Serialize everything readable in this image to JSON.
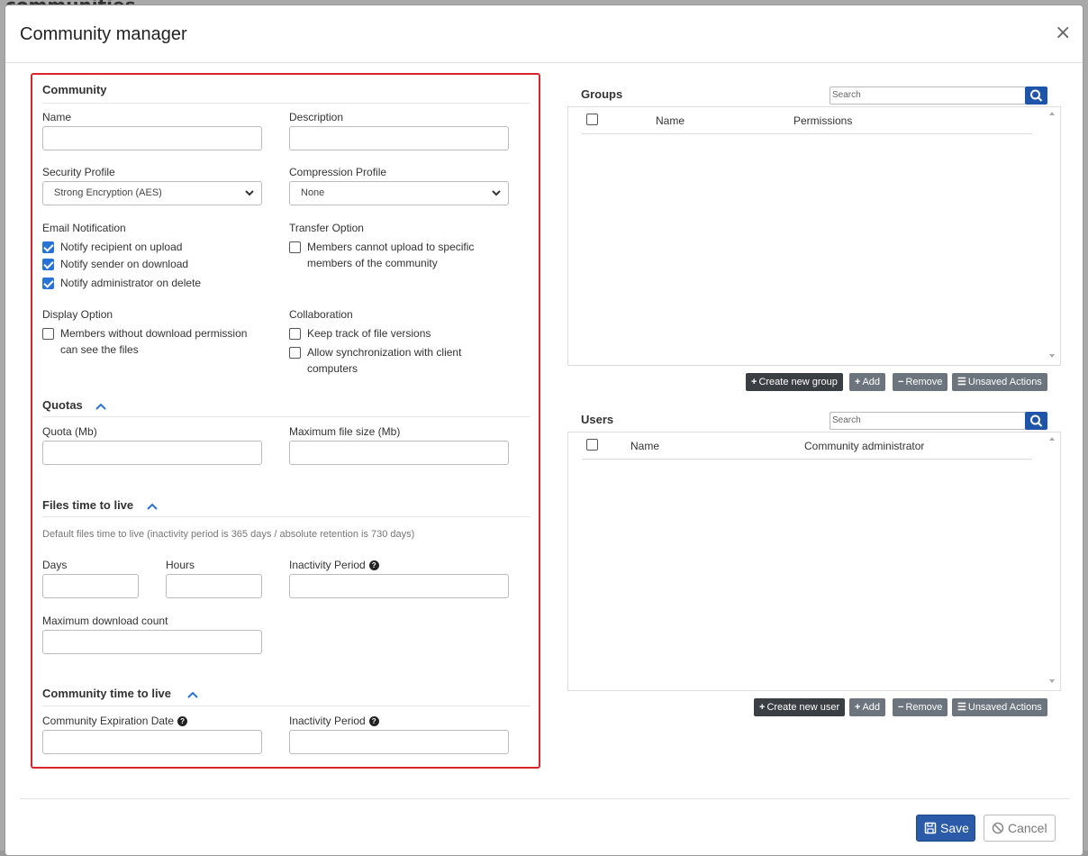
{
  "background": {
    "title_fragment": "communities"
  },
  "modal": {
    "title": "Community manager",
    "close_glyph": "×"
  },
  "community": {
    "title": "Community",
    "name_label": "Name",
    "description_label": "Description",
    "security_label": "Security Profile",
    "security_value": "Strong Encryption (AES)",
    "compression_label": "Compression Profile",
    "compression_value": "None",
    "email_label": "Email Notification",
    "email_options": [
      {
        "label": "Notify recipient on upload",
        "checked": true
      },
      {
        "label": "Notify sender on download",
        "checked": true
      },
      {
        "label": "Notify administrator on delete",
        "checked": true
      }
    ],
    "transfer_label": "Transfer Option",
    "transfer_option_line1": "Members cannot upload to specific",
    "transfer_option_line2": "members of the community",
    "display_label": "Display Option",
    "display_option_line1": "Members without download permission",
    "display_option_line2": "can see the files",
    "collab_label": "Collaboration",
    "collab_option1": "Keep track of file versions",
    "collab_option2_line1": "Allow synchronization with client",
    "collab_option2_line2": "computers"
  },
  "quotas": {
    "title": "Quotas",
    "quota_label": "Quota (Mb)",
    "maxsize_label": "Maximum file size (Mb)"
  },
  "files_ttl": {
    "title": "Files time to live",
    "hint": "Default files time to live (inactivity period is 365 days / absolute retention is 730 days)",
    "days_label": "Days",
    "hours_label": "Hours",
    "inactivity_label": "Inactivity Period",
    "maxdl_label": "Maximum download count"
  },
  "community_ttl": {
    "title": "Community time to live",
    "expiration_label": "Community Expiration Date",
    "inactivity_label": "Inactivity Period"
  },
  "groups": {
    "title": "Groups",
    "search_placeholder": "Search",
    "col_name": "Name",
    "col_permissions": "Permissions",
    "btn_create": "Create new group",
    "btn_add": "Add",
    "btn_remove": "Remove",
    "btn_unsaved": "Unsaved Actions"
  },
  "users": {
    "title": "Users",
    "search_placeholder": "Search",
    "col_name": "Name",
    "col_admin": "Community administrator",
    "btn_create": "Create new user",
    "btn_add": "Add",
    "btn_remove": "Remove",
    "btn_unsaved": "Unsaved Actions"
  },
  "footer": {
    "save": "Save",
    "cancel": "Cancel"
  },
  "colors": {
    "accent": "#2a73d6",
    "primary_button": "#2a5aa8",
    "highlight_border": "#d9262c",
    "dark_button": "#3a3f44",
    "gray_button": "#6c757d"
  }
}
